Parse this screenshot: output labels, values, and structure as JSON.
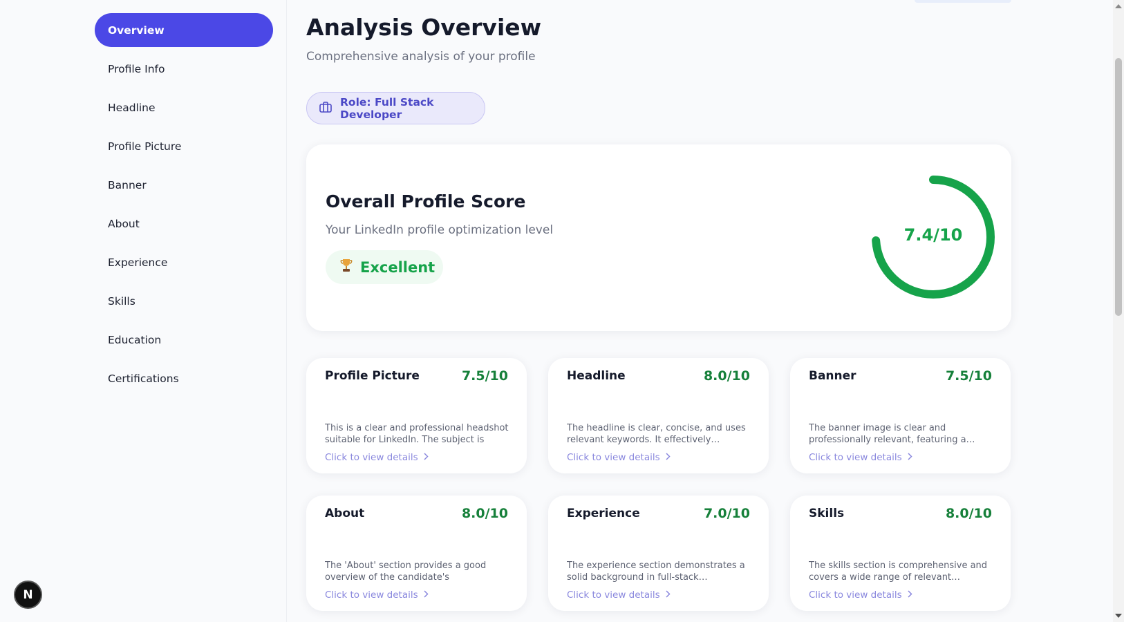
{
  "sidebar": {
    "items": [
      {
        "label": "Overview",
        "active": true
      },
      {
        "label": "Profile Info"
      },
      {
        "label": "Headline"
      },
      {
        "label": "Profile Picture"
      },
      {
        "label": "Banner"
      },
      {
        "label": "About"
      },
      {
        "label": "Experience"
      },
      {
        "label": "Skills"
      },
      {
        "label": "Education"
      },
      {
        "label": "Certifications"
      }
    ],
    "badge_letter": "N"
  },
  "header": {
    "title": "Analysis Overview",
    "subtitle": "Comprehensive analysis of your profile",
    "role_label": "Role: Full Stack Developer",
    "role_icon": "briefcase-icon"
  },
  "overall": {
    "title": "Overall Profile Score",
    "subtitle": "Your LinkedIn profile optimization level",
    "badge_icon": "trophy-icon",
    "badge_label": "Excellent",
    "score_text": "7.4/10",
    "score": 7.4,
    "max": 10,
    "accent_color": "#16a34a"
  },
  "sections": [
    {
      "title": "Profile Picture",
      "score": "7.5/10",
      "desc": "This is a clear and professional headshot suitable for LinkedIn. The subject is well-…",
      "link": "Click to view details"
    },
    {
      "title": "Headline",
      "score": "8.0/10",
      "desc": "The headline is clear, concise, and uses relevant keywords. It effectively…",
      "link": "Click to view details"
    },
    {
      "title": "Banner",
      "score": "7.5/10",
      "desc": "The banner image is clear and professionally relevant, featuring a…",
      "link": "Click to view details"
    },
    {
      "title": "About",
      "score": "8.0/10",
      "desc": "The 'About' section provides a good overview of the candidate's experience…",
      "link": "Click to view details"
    },
    {
      "title": "Experience",
      "score": "7.0/10",
      "desc": "The experience section demonstrates a solid background in full-stack…",
      "link": "Click to view details"
    },
    {
      "title": "Skills",
      "score": "8.0/10",
      "desc": "The skills section is comprehensive and covers a wide range of relevant…",
      "link": "Click to view details"
    }
  ],
  "colors": {
    "primary": "#4b48e6",
    "success": "#16a34a",
    "link": "#8a88de"
  }
}
